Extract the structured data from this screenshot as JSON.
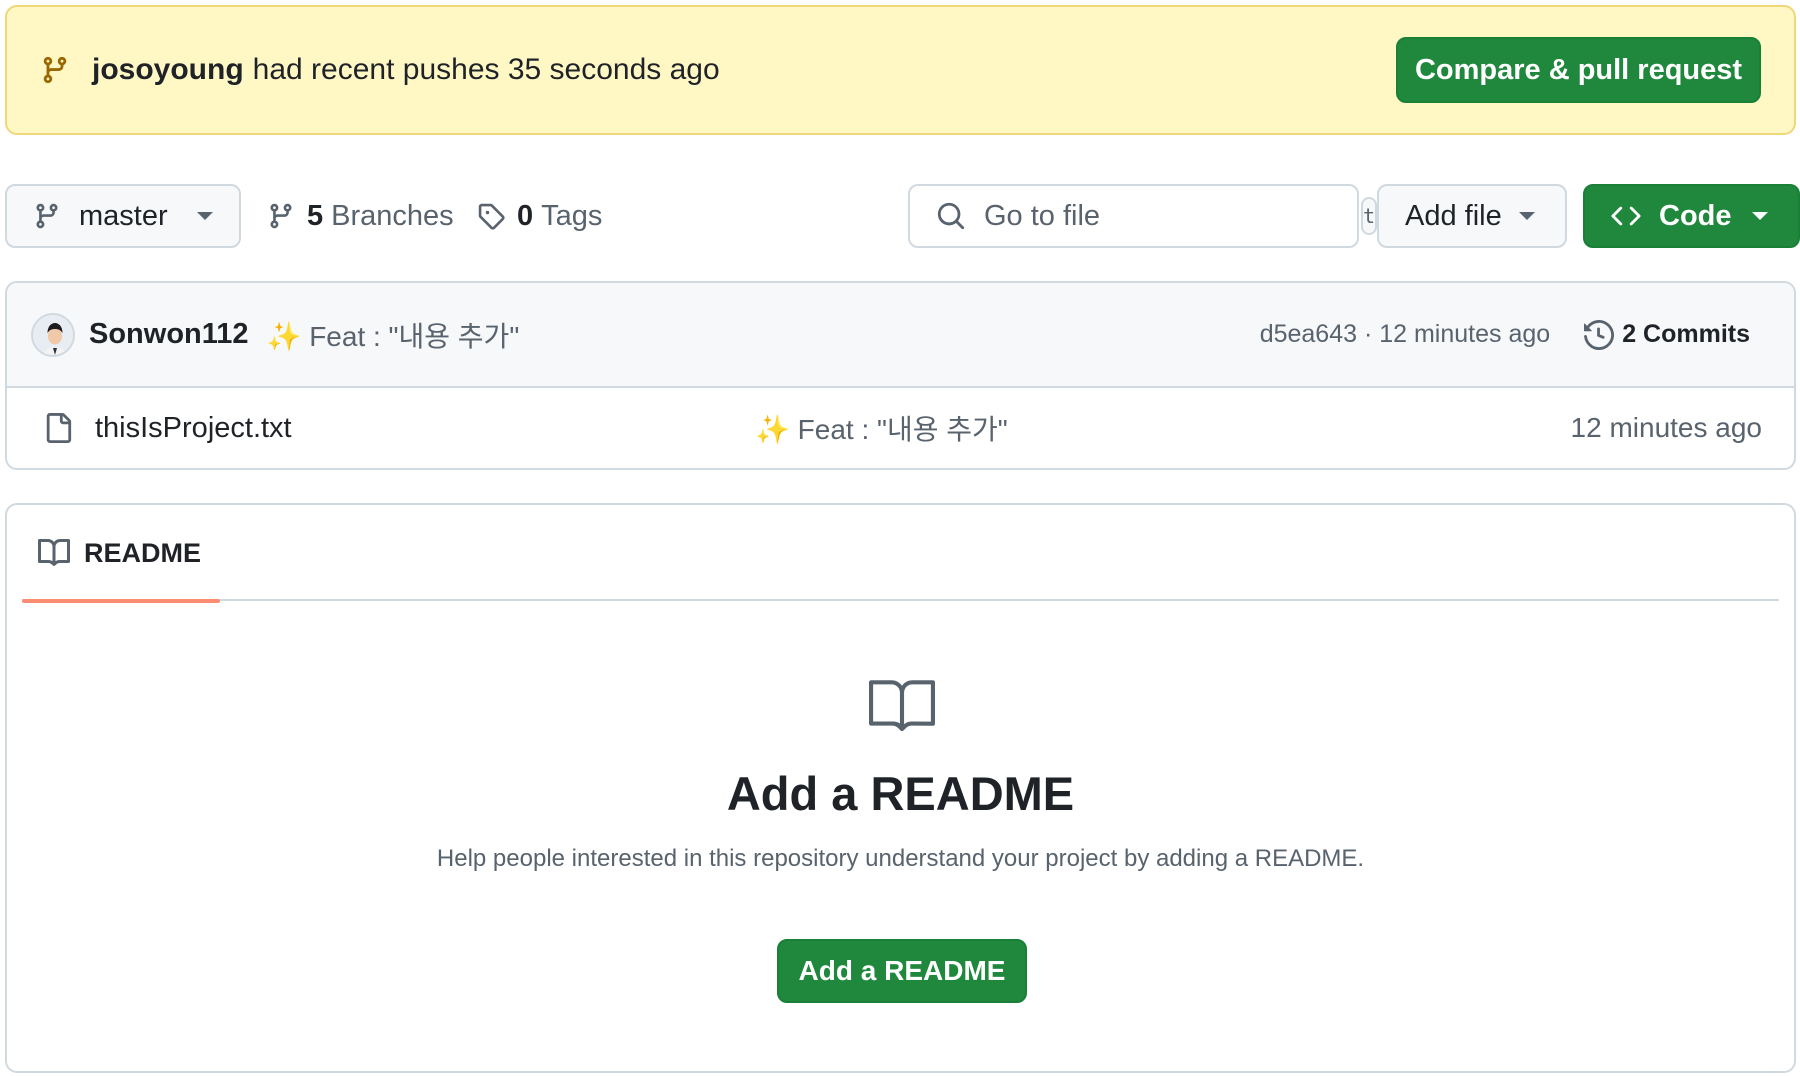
{
  "banner": {
    "user": "josoyoung",
    "message": "had recent pushes 35 seconds ago",
    "compare_button": "Compare & pull request"
  },
  "toolbar": {
    "branch": "master",
    "branches_count": "5",
    "branches_label": "Branches",
    "tags_count": "0",
    "tags_label": "Tags",
    "go_to_file_placeholder": "Go to file",
    "go_to_file_shortcut": "t",
    "add_file_label": "Add file",
    "code_label": "Code"
  },
  "latest_commit": {
    "author": "Sonwon112",
    "message": "✨ Feat : \"내용 추가\"",
    "meta": "d5ea643 · 12 minutes ago",
    "commits_label": "2 Commits"
  },
  "files": [
    {
      "name": "thisIsProject.txt",
      "commit": "✨ Feat : \"내용 추가\"",
      "age": "12 minutes ago"
    }
  ],
  "readme": {
    "tab_label": "README",
    "title": "Add a README",
    "description": "Help people interested in this repository understand your project by adding a README.",
    "button_label": "Add a README"
  },
  "colors": {
    "banner_bg": "#fff8c5",
    "primary_button": "#1f883d",
    "tab_underline": "#fd8c73",
    "muted_text": "#59636e"
  },
  "icons": [
    "git-branch-icon",
    "search-icon",
    "tag-icon",
    "code-icon",
    "history-icon",
    "file-icon",
    "book-icon"
  ]
}
